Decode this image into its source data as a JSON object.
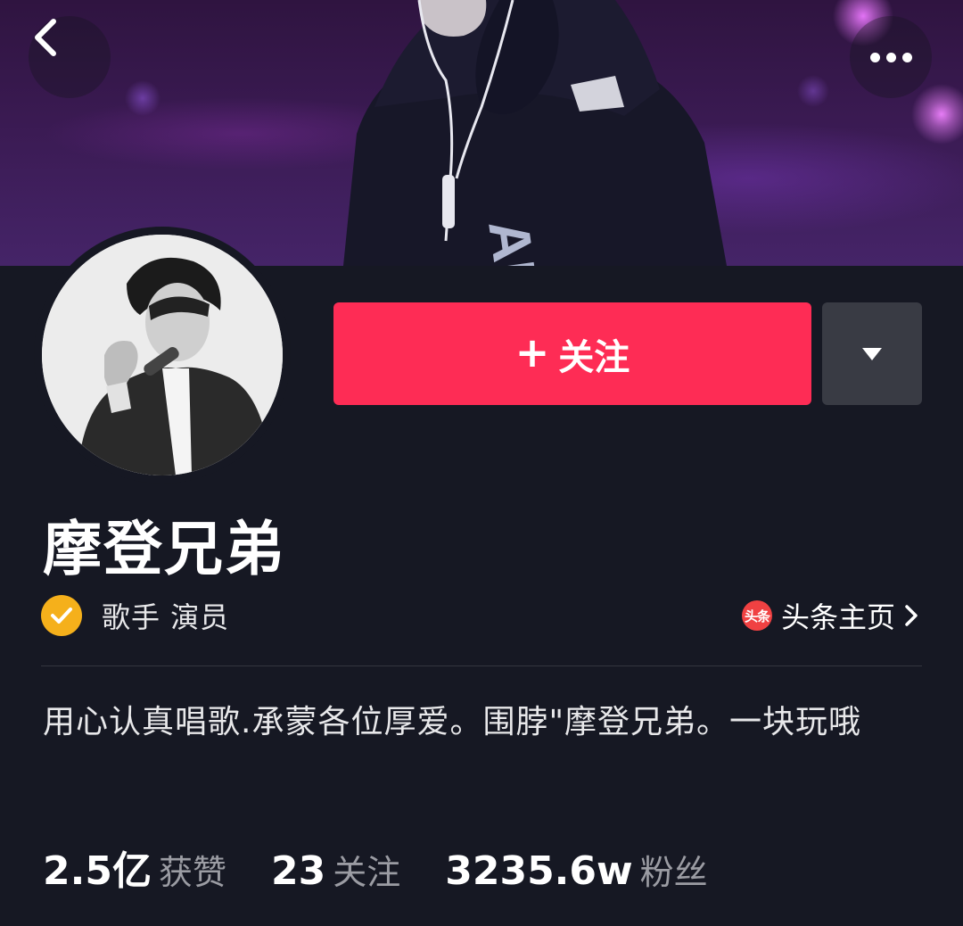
{
  "header": {
    "back_icon": "chevron-left-icon",
    "more_icon": "more-dots-icon"
  },
  "profile": {
    "name": "摩登兄弟",
    "verified_icon": "verified-check-icon",
    "verified_color": "#f5b01b",
    "verified_title": "歌手 演员",
    "toutiao_logo": "头条",
    "toutiao_link": "头条主页",
    "bio": "用心认真唱歌.承蒙各位厚爱。围脖\"摩登兄弟。一块玩哦"
  },
  "actions": {
    "follow_plus": "+",
    "follow_label": "关注",
    "follow_color": "#fe2c55",
    "dropdown_icon": "caret-down-icon"
  },
  "stats": [
    {
      "value": "2.5亿",
      "label": "获赞"
    },
    {
      "value": "23",
      "label": "关注"
    },
    {
      "value": "3235.6w",
      "label": "粉丝"
    }
  ]
}
